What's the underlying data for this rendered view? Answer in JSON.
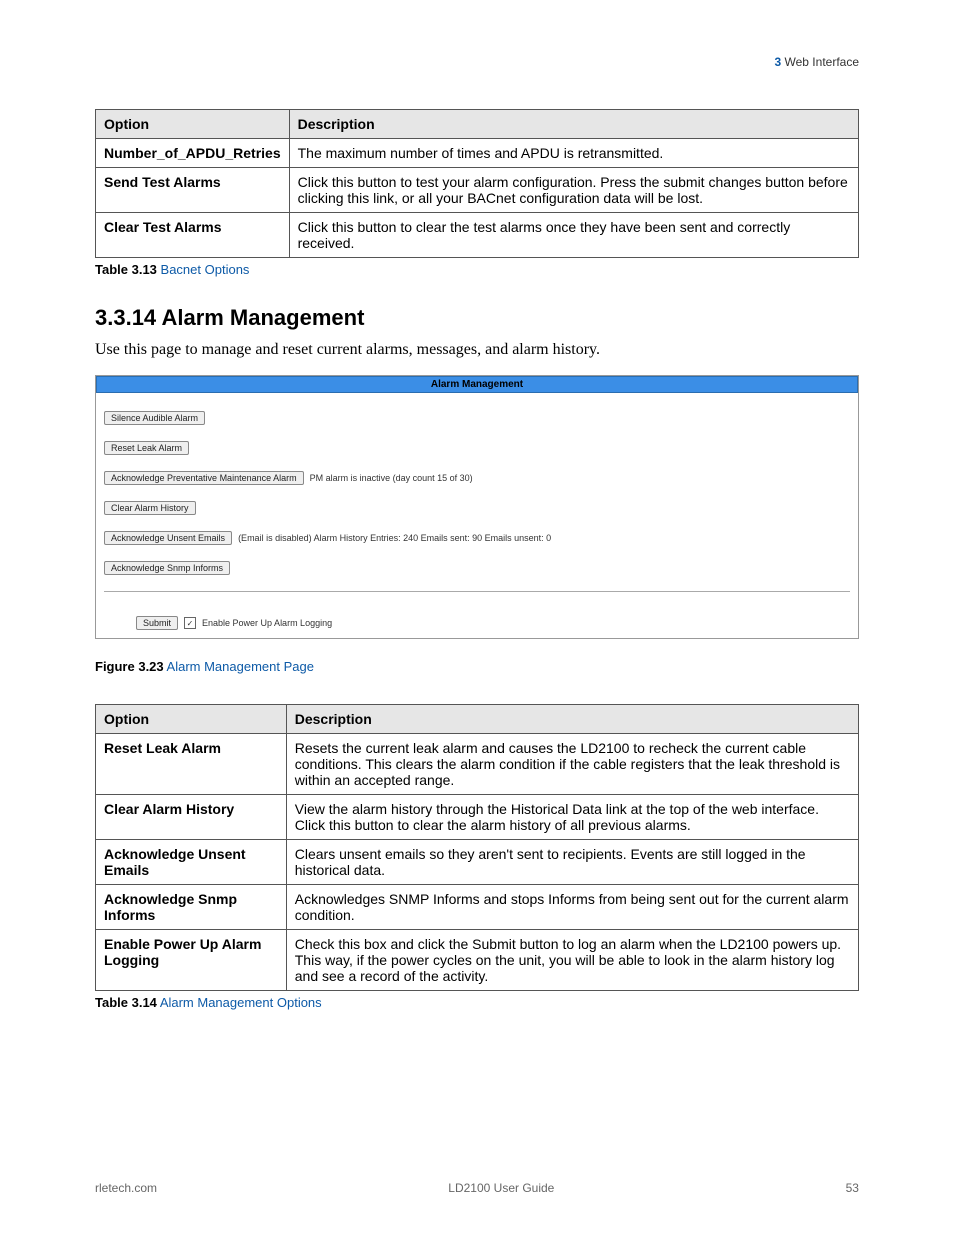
{
  "header": {
    "chapter": "3",
    "title": "Web Interface"
  },
  "table1": {
    "headers": [
      "Option",
      "Description"
    ],
    "rows": [
      {
        "opt": "Number_of_APDU_Retries",
        "desc": "The maximum number of times and APDU is retransmitted."
      },
      {
        "opt": "Send Test Alarms",
        "desc": "Click this button to test your alarm configuration. Press the submit changes button before clicking this link, or all your BACnet configuration data will be lost."
      },
      {
        "opt": "Clear Test Alarms",
        "desc": "Click this button to clear the test alarms once they have been sent and correctly received."
      }
    ],
    "caption_bold": "Table 3.13",
    "caption_link": "Bacnet Options"
  },
  "section": {
    "num_title": "3.3.14 Alarm Management",
    "body": "Use this page to manage and reset current alarms, messages, and alarm history."
  },
  "screenshot": {
    "bar": "Alarm Management",
    "b1": "Silence Audible Alarm",
    "b2": "Reset Leak Alarm",
    "b3": "Acknowledge Preventative Maintenance Alarm",
    "b3_note": "PM alarm is inactive (day count 15 of 30)",
    "b4": "Clear Alarm History",
    "b5": "Acknowledge Unsent Emails",
    "b5_note": "(Email is disabled) Alarm History Entries: 240 Emails sent: 90 Emails unsent: 0",
    "b6": "Acknowledge Snmp Informs",
    "submit": "Submit",
    "check_label": "Enable Power Up Alarm Logging"
  },
  "fig_caption": {
    "bold": "Figure 3.23",
    "link": "Alarm Management Page"
  },
  "table2": {
    "headers": [
      "Option",
      "Description"
    ],
    "rows": [
      {
        "opt": "Reset Leak Alarm",
        "desc": "Resets the current leak alarm and causes the LD2100 to recheck the current cable conditions. This clears the alarm condition if the cable registers that the leak threshold is within an accepted range."
      },
      {
        "opt": "Clear Alarm History",
        "desc": "View the alarm history through the Historical Data link at the top of the web interface. Click this button to clear the alarm history of all previous alarms."
      },
      {
        "opt": "Acknowledge Unsent Emails",
        "desc": "Clears unsent emails so they aren't sent to recipients. Events are still logged in the historical data."
      },
      {
        "opt": "Acknowledge Snmp Informs",
        "desc": "Acknowledges SNMP Informs and stops Informs from being sent out for the current alarm condition."
      },
      {
        "opt": "Enable Power Up Alarm Logging",
        "desc": "Check this box and click the Submit button to log an alarm when the LD2100 powers up. This way, if the power cycles on the unit, you will be able to look in the alarm history log and see a record of the activity."
      }
    ],
    "caption_bold": "Table 3.14",
    "caption_link": "Alarm Management Options"
  },
  "footer": {
    "left": "rletech.com",
    "center": "LD2100 User Guide",
    "right": "53"
  }
}
